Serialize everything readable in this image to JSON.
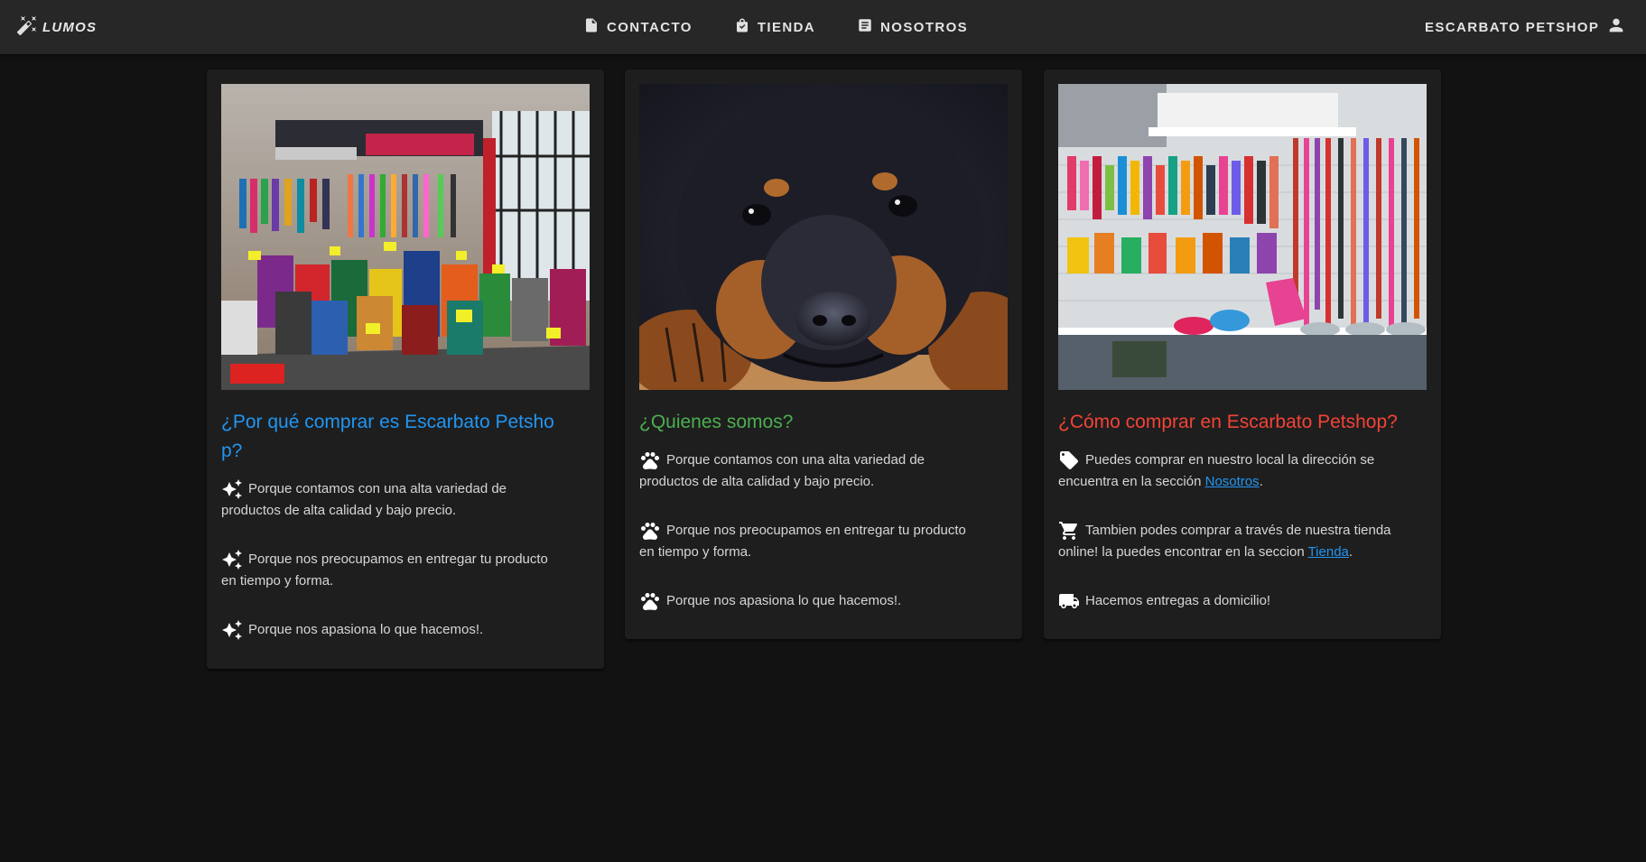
{
  "appbar": {
    "brand": "LUMOS",
    "nav": [
      {
        "label": "CONTACTO",
        "icon": "contact-page-icon"
      },
      {
        "label": "TIENDA",
        "icon": "shopping-bag-icon"
      },
      {
        "label": "NOSOTROS",
        "icon": "article-icon"
      }
    ],
    "shop_name": "ESCARBATO PETSHOP",
    "account_icon": "account-icon"
  },
  "colors": {
    "background": "#121212",
    "appbar": "#272727",
    "card": "#1e1e1e",
    "blue": "#2196f3",
    "green": "#4caf50",
    "red": "#f44336"
  },
  "cards": [
    {
      "title": "¿Por qué comprar es Escarbato Petshop?",
      "title_color": "#2196f3",
      "image": "pet-store-interior-photo",
      "items": [
        {
          "icon": "sparkles-icon",
          "text": "Porque contamos con una alta variedad de productos de alta calidad y bajo precio."
        },
        {
          "icon": "sparkles-icon",
          "text": "Porque nos preocupamos en entregar tu producto en tiempo y forma."
        },
        {
          "icon": "sparkles-icon",
          "text": "Porque nos apasiona lo que hacemos!."
        }
      ]
    },
    {
      "title": "¿Quienes somos?",
      "title_color": "#4caf50",
      "image": "rottweiler-puppy-photo",
      "items": [
        {
          "icon": "paw-icon",
          "text": "Porque contamos con una alta variedad de productos de alta calidad y bajo precio."
        },
        {
          "icon": "paw-icon",
          "text": "Porque nos preocupamos en entregar tu producto en tiempo y forma."
        },
        {
          "icon": "paw-icon",
          "text": "Porque nos apasiona lo que hacemos!."
        }
      ]
    },
    {
      "title": "¿Cómo comprar en Escarbato Petshop?",
      "title_color": "#f44336",
      "image": "pet-accessories-wall-photo",
      "items": [
        {
          "icon": "tag-icon",
          "text_before": "Puedes comprar en nuestro local la dirección se encuentra en la sección ",
          "link": "Nosotros",
          "text_after": "."
        },
        {
          "icon": "cart-icon",
          "text_before": "Tambien podes comprar a través de nuestra tienda online! la puedes encontrar en la seccion ",
          "link": "Tienda",
          "text_after": "."
        },
        {
          "icon": "truck-icon",
          "text": "Hacemos entregas a domicilio!"
        }
      ]
    }
  ]
}
